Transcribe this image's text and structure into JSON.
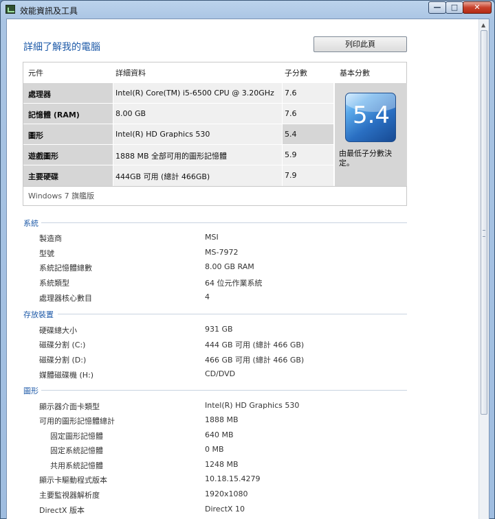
{
  "window": {
    "title": "效能資訊及工具"
  },
  "page": {
    "title": "詳細了解我的電腦",
    "print_label": "列印此頁"
  },
  "score_table": {
    "headers": {
      "component": "元件",
      "details": "詳細資料",
      "subscore": "子分數",
      "base": "基本分數"
    },
    "rows": [
      {
        "label": "處理器",
        "detail": "Intel(R) Core(TM) i5-6500 CPU @ 3.20GHz",
        "score": "7.6"
      },
      {
        "label": "記憶體 (RAM)",
        "detail": "8.00 GB",
        "score": "7.6"
      },
      {
        "label": "圖形",
        "detail": "Intel(R) HD Graphics 530",
        "score": "5.4"
      },
      {
        "label": "遊戲圖形",
        "detail": "1888 MB 全部可用的圖形記憶體",
        "score": "5.9"
      },
      {
        "label": "主要硬碟",
        "detail": "444GB 可用 (總計 466GB)",
        "score": "7.9"
      }
    ],
    "base_score": "5.4",
    "base_caption": "由最低子分數決定。",
    "edition": "Windows 7 旗艦版"
  },
  "system": {
    "heading": "系統",
    "items": [
      {
        "label": "製造商",
        "value": "MSI"
      },
      {
        "label": "型號",
        "value": "MS-7972"
      },
      {
        "label": "系統記憶體總數",
        "value": "8.00 GB RAM"
      },
      {
        "label": "系統類型",
        "value": "64 位元作業系統"
      },
      {
        "label": "處理器核心數目",
        "value": "4"
      }
    ]
  },
  "storage": {
    "heading": "存放裝置",
    "items": [
      {
        "label": "硬碟總大小",
        "value": "931 GB"
      },
      {
        "label": "磁碟分割 (C:)",
        "value": "444 GB 可用 (總計 466 GB)"
      },
      {
        "label": "磁碟分割 (D:)",
        "value": "466 GB 可用 (總計 466 GB)"
      },
      {
        "label": "媒體磁碟機 (H:)",
        "value": "CD/DVD"
      }
    ]
  },
  "graphics": {
    "heading": "圖形",
    "items": [
      {
        "label": "顯示器介面卡類型",
        "value": "Intel(R) HD Graphics 530"
      },
      {
        "label": "可用的圖形記憶體總計",
        "value": "1888 MB"
      },
      {
        "label": "固定圖形記憶體",
        "value": "640 MB"
      },
      {
        "label": "固定系統記憶體",
        "value": "0 MB"
      },
      {
        "label": "共用系統記憶體",
        "value": "1248 MB"
      },
      {
        "label": "顯示卡驅動程式版本",
        "value": "10.18.15.4279"
      },
      {
        "label": "主要監視器解析度",
        "value": "1920x1080"
      },
      {
        "label": "DirectX 版本",
        "value": "DirectX 10"
      }
    ]
  }
}
